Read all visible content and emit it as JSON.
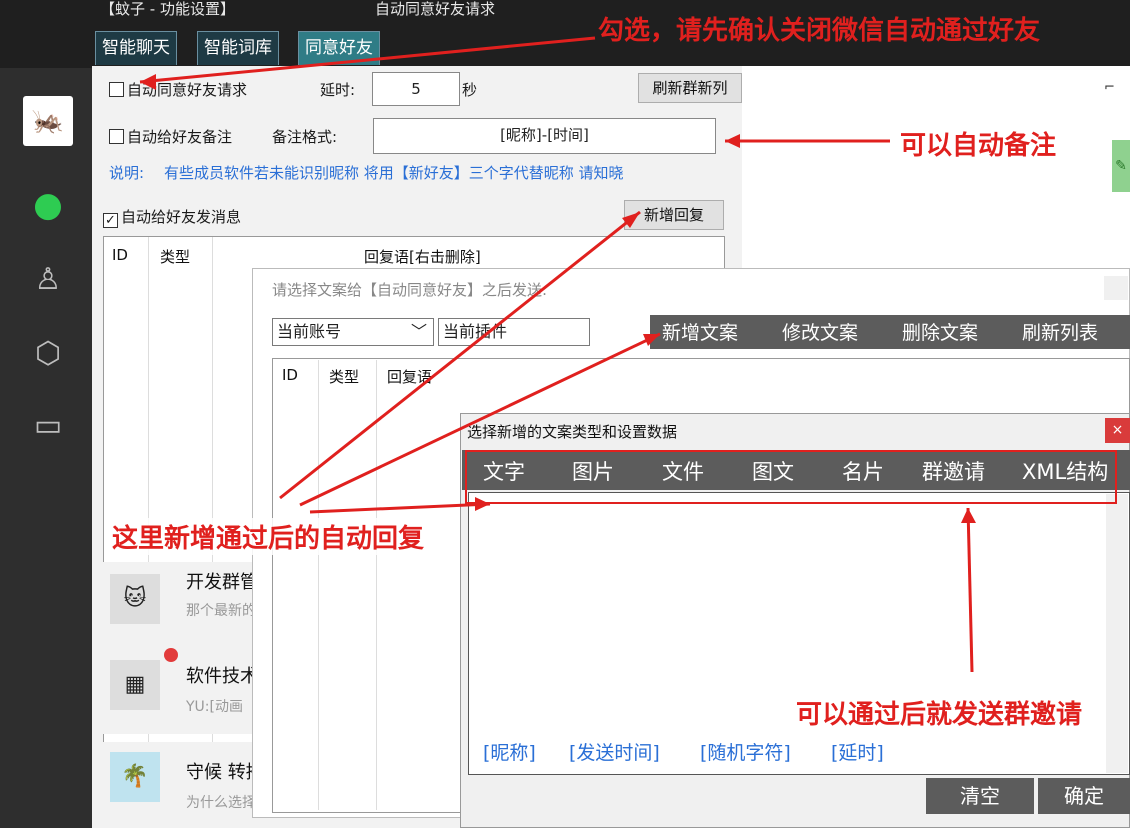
{
  "window": {
    "title_left": "【蚊子 - 功能设置】",
    "title_mid": "自动同意好友请求",
    "tabs": [
      "智能聊天",
      "智能词库",
      "同意好友"
    ]
  },
  "settings": {
    "auto_accept_label": "自动同意好友请求",
    "delay_label": "延时:",
    "delay_value": "5",
    "delay_unit": "秒",
    "refresh_group_btn": "刷新群新列",
    "auto_remark_label": "自动给好友备注",
    "remark_format_label": "备注格式:",
    "remark_format_value": "[昵称]-[时间]",
    "note_prefix": "说明:",
    "note_text": "有些成员软件若未能识别昵称 将用【新好友】三个字代替昵称 请知晓",
    "auto_msg_label": "自动给好友发消息",
    "auto_msg_checked": "✓",
    "new_reply_btn": "新增回复",
    "table_headers": [
      "ID",
      "类型",
      "回复语[右击删除]"
    ]
  },
  "chat_list": [
    {
      "name": "开发群管",
      "sub": "那个最新的",
      "avatar": "🐱"
    },
    {
      "name": "软件技术",
      "sub": "YU:[动画",
      "avatar": "▦"
    },
    {
      "name": "守候 转播",
      "sub": "为什么选择",
      "avatar": "🌴"
    }
  ],
  "dialog1": {
    "title": "请选择文案给【自动同意好友】之后发送:",
    "account_combo": "当前账号",
    "plugin_combo": "当前插件",
    "toolbar": [
      "新增文案",
      "修改文案",
      "删除文案",
      "刷新列表"
    ],
    "table_headers": [
      "ID",
      "类型",
      "回复语"
    ]
  },
  "dialog2": {
    "title": "选择新增的文案类型和设置数据",
    "close": "×",
    "types": [
      "文字",
      "图片",
      "文件",
      "图文",
      "名片",
      "群邀请",
      "XML结构"
    ],
    "variables": [
      "[昵称]",
      "[发送时间]",
      "[随机字符]",
      "[延时]"
    ],
    "btn_clear": "清空",
    "btn_ok": "确定"
  },
  "annotations": {
    "check": "勾选，请先确认关闭微信自动通过好友",
    "remark": "可以自动备注",
    "reply": "这里新增通过后的自动回复",
    "group": "可以通过后就发送群邀请"
  },
  "colors": {
    "annotation_red": "#e0201e",
    "toolbar_gray": "#5c5c5c",
    "wechat_green": "#2ecc52",
    "link_blue": "#2a6fd6"
  }
}
